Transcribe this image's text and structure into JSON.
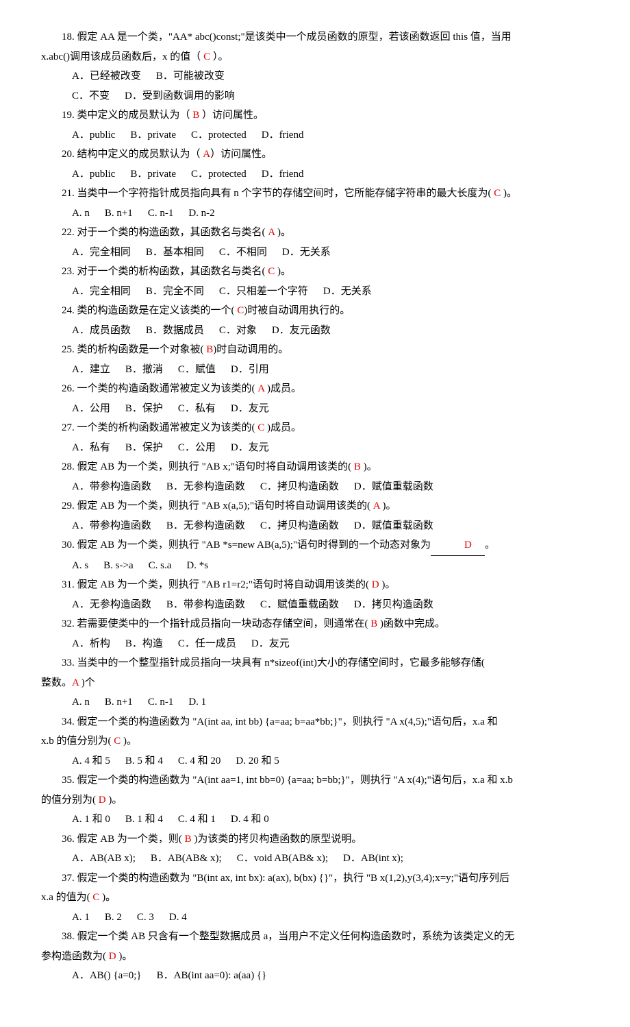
{
  "items": [
    {
      "type": "q",
      "num": "18.",
      "pre": " 假定 AA 是一个类，\"AA* abc()const;\"是该类中一个成员函数的原型，若该函数返回 this 值，当用",
      "ans": "",
      "post": ""
    },
    {
      "type": "noindent",
      "pre": "x.abc()调用该成员函数后，x 的值（ ",
      "ans": "C",
      "post": " ）。"
    },
    {
      "type": "opt",
      "opts": [
        "A．已经被改变",
        "B．可能被改变"
      ]
    },
    {
      "type": "opt",
      "opts": [
        "C．不变",
        "D．受到函数调用的影响"
      ]
    },
    {
      "type": "q",
      "num": "19.",
      "pre": " 类中定义的成员默认为（ ",
      "ans": "B",
      "post": "  ）访问属性。"
    },
    {
      "type": "opt",
      "opts": [
        "A．public",
        "B．private",
        "C．protected",
        "D．friend"
      ]
    },
    {
      "type": "q",
      "num": "20.",
      "pre": " 结构中定义的成员默认为（  ",
      "ans": "A",
      "post": "）访问属性。"
    },
    {
      "type": "opt",
      "opts": [
        "A．public",
        "B．private",
        "C．protected",
        "D．friend"
      ]
    },
    {
      "type": "q",
      "num": "21.",
      "pre": " 当类中一个字符指针成员指向具有 n 个字节的存储空间时，它所能存储字符串的最大长度为(  ",
      "ans": "C",
      "post": " )。"
    },
    {
      "type": "opt",
      "opts": [
        "A. n",
        "B. n+1",
        "C. n-1",
        "D. n-2"
      ]
    },
    {
      "type": "q",
      "num": "22.",
      "pre": " 对于一个类的构造函数，其函数名与类名(  ",
      "ans": "A",
      "post": " )。"
    },
    {
      "type": "opt",
      "opts": [
        "A．完全相同",
        "B．基本相同",
        "C．不相同",
        "D．无关系"
      ]
    },
    {
      "type": "q",
      "num": "23.",
      "pre": " 对于一个类的析构函数，其函数名与类名(  ",
      "ans": "C",
      "post": " )。"
    },
    {
      "type": "opt",
      "opts": [
        "A．完全相同",
        "B．完全不同",
        "C．只相差一个字符",
        "D．无关系"
      ]
    },
    {
      "type": "q",
      "num": "24.",
      "pre": " 类的构造函数是在定义该类的一个(   ",
      "ans": "C",
      "post": ")时被自动调用执行的。"
    },
    {
      "type": "opt",
      "opts": [
        "A．成员函数",
        "B．数据成员",
        "C．对象",
        "D．友元函数"
      ]
    },
    {
      "type": "q",
      "num": "25.",
      "pre": " 类的析构函数是一个对象被(   ",
      "ans": "B",
      "post": ")时自动调用的。"
    },
    {
      "type": "opt",
      "opts": [
        "A．建立",
        "B．撤消",
        "C．赋值",
        "D．引用"
      ]
    },
    {
      "type": "q",
      "num": "26.",
      "pre": " 一个类的构造函数通常被定义为该类的(  ",
      "ans": "A",
      "post": " )成员。"
    },
    {
      "type": "opt",
      "opts": [
        "A．公用",
        "B．保护",
        "C．私有",
        "D．友元"
      ]
    },
    {
      "type": "q",
      "num": "27.",
      "pre": " 一个类的析构函数通常被定义为该类的(  ",
      "ans": "C",
      "post": " )成员。"
    },
    {
      "type": "opt",
      "opts": [
        "A．私有",
        "B．保护",
        "C．公用",
        "D．友元"
      ]
    },
    {
      "type": "q",
      "num": "28.",
      "pre": " 假定 AB 为一个类，则执行 \"AB x;\"语句时将自动调用该类的(  ",
      "ans": "B",
      "post": " )。"
    },
    {
      "type": "opt",
      "opts": [
        "A．带参构造函数",
        "B．无参构造函数",
        "C．拷贝构造函数",
        "D．赋值重载函数"
      ]
    },
    {
      "type": "q",
      "num": "29.",
      "pre": " 假定 AB 为一个类，则执行 \"AB x(a,5);\"语句时将自动调用该类的(  ",
      "ans": "A",
      "post": " )。"
    },
    {
      "type": "opt",
      "opts": [
        "A．带参构造函数",
        "B．无参构造函数",
        "C．拷贝构造函数",
        "D．赋值重载函数"
      ]
    },
    {
      "type": "q",
      "num": "30.",
      "pre": " 假定 AB 为一个类，则执行 \"AB *s=new AB(a,5);\"语句时得到的一个动态对象为",
      "ans": "D",
      "post": "。",
      "blank": true
    },
    {
      "type": "opt",
      "opts": [
        "A. s",
        "B. s->a",
        "C. s.a",
        "D. *s"
      ]
    },
    {
      "type": "q",
      "num": "31.",
      "pre": " 假定 AB 为一个类，则执行 \"AB r1=r2;\"语句时将自动调用该类的(  ",
      "ans": "D",
      "post": " )。"
    },
    {
      "type": "opt",
      "opts": [
        "A．无参构造函数",
        "B．带参构造函数",
        "C．赋值重载函数",
        "D．拷贝构造函数"
      ]
    },
    {
      "type": "q",
      "num": "32.",
      "pre": " 若需要使类中的一个指针成员指向一块动态存储空间，则通常在( ",
      "ans": "B",
      "post": "  )函数中完成。"
    },
    {
      "type": "opt",
      "opts": [
        "A．析构",
        "B．构造",
        "C．任一成员",
        "D．友元"
      ]
    },
    {
      "type": "q",
      "num": "33.",
      "pre": " 当类中的一个整型指针成员指向一块具有 n*sizeof(int)大小的存储空间时，它最多能够存储(  ",
      "ans": "A",
      "post": " )个",
      "cont": "整数。"
    },
    {
      "type": "opt",
      "opts": [
        "A. n",
        "B. n+1",
        "C. n-1",
        "D. 1"
      ]
    },
    {
      "type": "q",
      "num": "34.",
      "pre": " 假定一个类的构造函数为 \"A(int aa, int bb) {a=aa; b=aa*bb;}\"，则执行 \"A  x(4,5);\"语句后，x.a 和",
      "cont": "x.b 的值分别为(  ",
      "ans": "C",
      "post": " )。"
    },
    {
      "type": "opt",
      "opts": [
        "A. 4 和 5",
        "B. 5 和 4",
        "C. 4 和 20",
        "D. 20 和 5"
      ]
    },
    {
      "type": "q",
      "num": "35.",
      "pre": " 假定一个类的构造函数为 \"A(int aa=1, int bb=0) {a=aa; b=bb;}\"，则执行 \"A x(4);\"语句后，x.a 和 x.b",
      "cont": "的值分别为( ",
      "ans": "D",
      "post": "  )。"
    },
    {
      "type": "opt",
      "opts": [
        "A. 1 和 0",
        "B. 1 和 4",
        "C. 4 和 1",
        "D. 4 和 0"
      ]
    },
    {
      "type": "q",
      "num": "36.",
      "pre": " 假定 AB 为一个类，则(  ",
      "ans": "B",
      "post": " )为该类的拷贝构造函数的原型说明。"
    },
    {
      "type": "opt",
      "opts": [
        "A．AB(AB x);",
        "B．AB(AB& x);",
        "C．void AB(AB& x);",
        "D．AB(int x);"
      ]
    },
    {
      "type": "q",
      "num": "37.",
      "pre": " 假定一个类的构造函数为 \"B(int ax, int bx): a(ax), b(bx) {}\"，执行 \"B x(1,2),y(3,4);x=y;\"语句序列后",
      "cont": "x.a 的值为(  ",
      "ans": "C",
      "post": " )。"
    },
    {
      "type": "opt",
      "opts": [
        "A. 1",
        "B. 2",
        "C. 3",
        "D. 4"
      ]
    },
    {
      "type": "q",
      "num": "38.",
      "pre": " 假定一个类 AB 只含有一个整型数据成员 a，当用户不定义任何构造函数时，系统为该类定义的无",
      "cont": "参构造函数为(  ",
      "ans": "D",
      "post": " )。"
    },
    {
      "type": "opt",
      "opts": [
        "A．AB() {a=0;}",
        "B．AB(int aa=0): a(aa) {}"
      ]
    }
  ]
}
